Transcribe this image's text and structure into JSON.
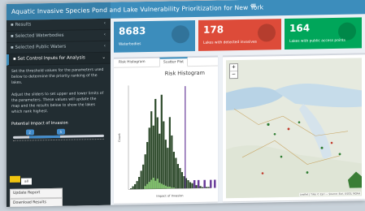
{
  "app": {
    "title": "Aquatic Invasive Species Pond and Lake Vulnerability Prioritization for New York",
    "menu_toggle": "≡"
  },
  "sidebar": {
    "items": [
      {
        "label": "Results",
        "icon": "chart-icon"
      },
      {
        "label": "Selected Waterbodies",
        "icon": "water-icon"
      },
      {
        "label": "Selected Public Waters",
        "icon": "table-icon"
      },
      {
        "label": "Set Control Inputs for Analysis",
        "icon": "sliders-icon",
        "active": true
      }
    ],
    "description": [
      "Set the threshold values for the parameters used below to determine the priority ranking of the lakes.",
      "Adjust the sliders to set upper and lower limits of the parameters. These values will update the map and the results below to show the lakes which rank highest."
    ],
    "slider": {
      "label": "Potential Impact of Invasion",
      "low_value": "2",
      "high_value": "5",
      "level_low": 0.18,
      "level_high": 0.52
    },
    "swatches": [
      {
        "label": "",
        "color": "#f1c40f"
      },
      {
        "label": "all",
        "color": "#ffffff"
      }
    ],
    "buttons": [
      "Update Report",
      "Download Results"
    ]
  },
  "value_boxes": [
    {
      "value": "8683",
      "label": "Waterbodies",
      "color": "#3c8dbc",
      "icon": "globe-icon"
    },
    {
      "value": "178",
      "label": "Lakes with detected invasives",
      "color": "#dd4b39",
      "icon": "arrow-down-icon"
    },
    {
      "value": "164",
      "label": "Lakes with public access points",
      "color": "#00a65a",
      "icon": "check-icon"
    }
  ],
  "plot_panel": {
    "tabs": [
      "Risk Histogram",
      "Scatter Plot"
    ],
    "active_tab": 1
  },
  "map": {
    "zoom_in": "+",
    "zoom_out": "−",
    "attribution": "Leaflet | Tiles © Esri — Source: Esri, USGS, NOAA"
  },
  "chart_data": {
    "type": "bar",
    "title": "Risk Histogram",
    "xlabel": "Impact of Invasion",
    "ylabel": "Count",
    "values": [
      1,
      3,
      5,
      8,
      12,
      18,
      24,
      34,
      46,
      60,
      76,
      62,
      88,
      70,
      54,
      92,
      66,
      48,
      40,
      70,
      52,
      36,
      30,
      24,
      20,
      16,
      12,
      10,
      8,
      6,
      5,
      4,
      3,
      2,
      2,
      1,
      1,
      1,
      1
    ],
    "highlight": [
      3,
      5,
      7,
      9,
      11,
      8,
      10,
      6,
      5,
      4,
      3,
      2,
      2,
      1,
      1
    ],
    "highlight_start": 7,
    "threshold_index": 27,
    "ylim": [
      0,
      100
    ]
  }
}
